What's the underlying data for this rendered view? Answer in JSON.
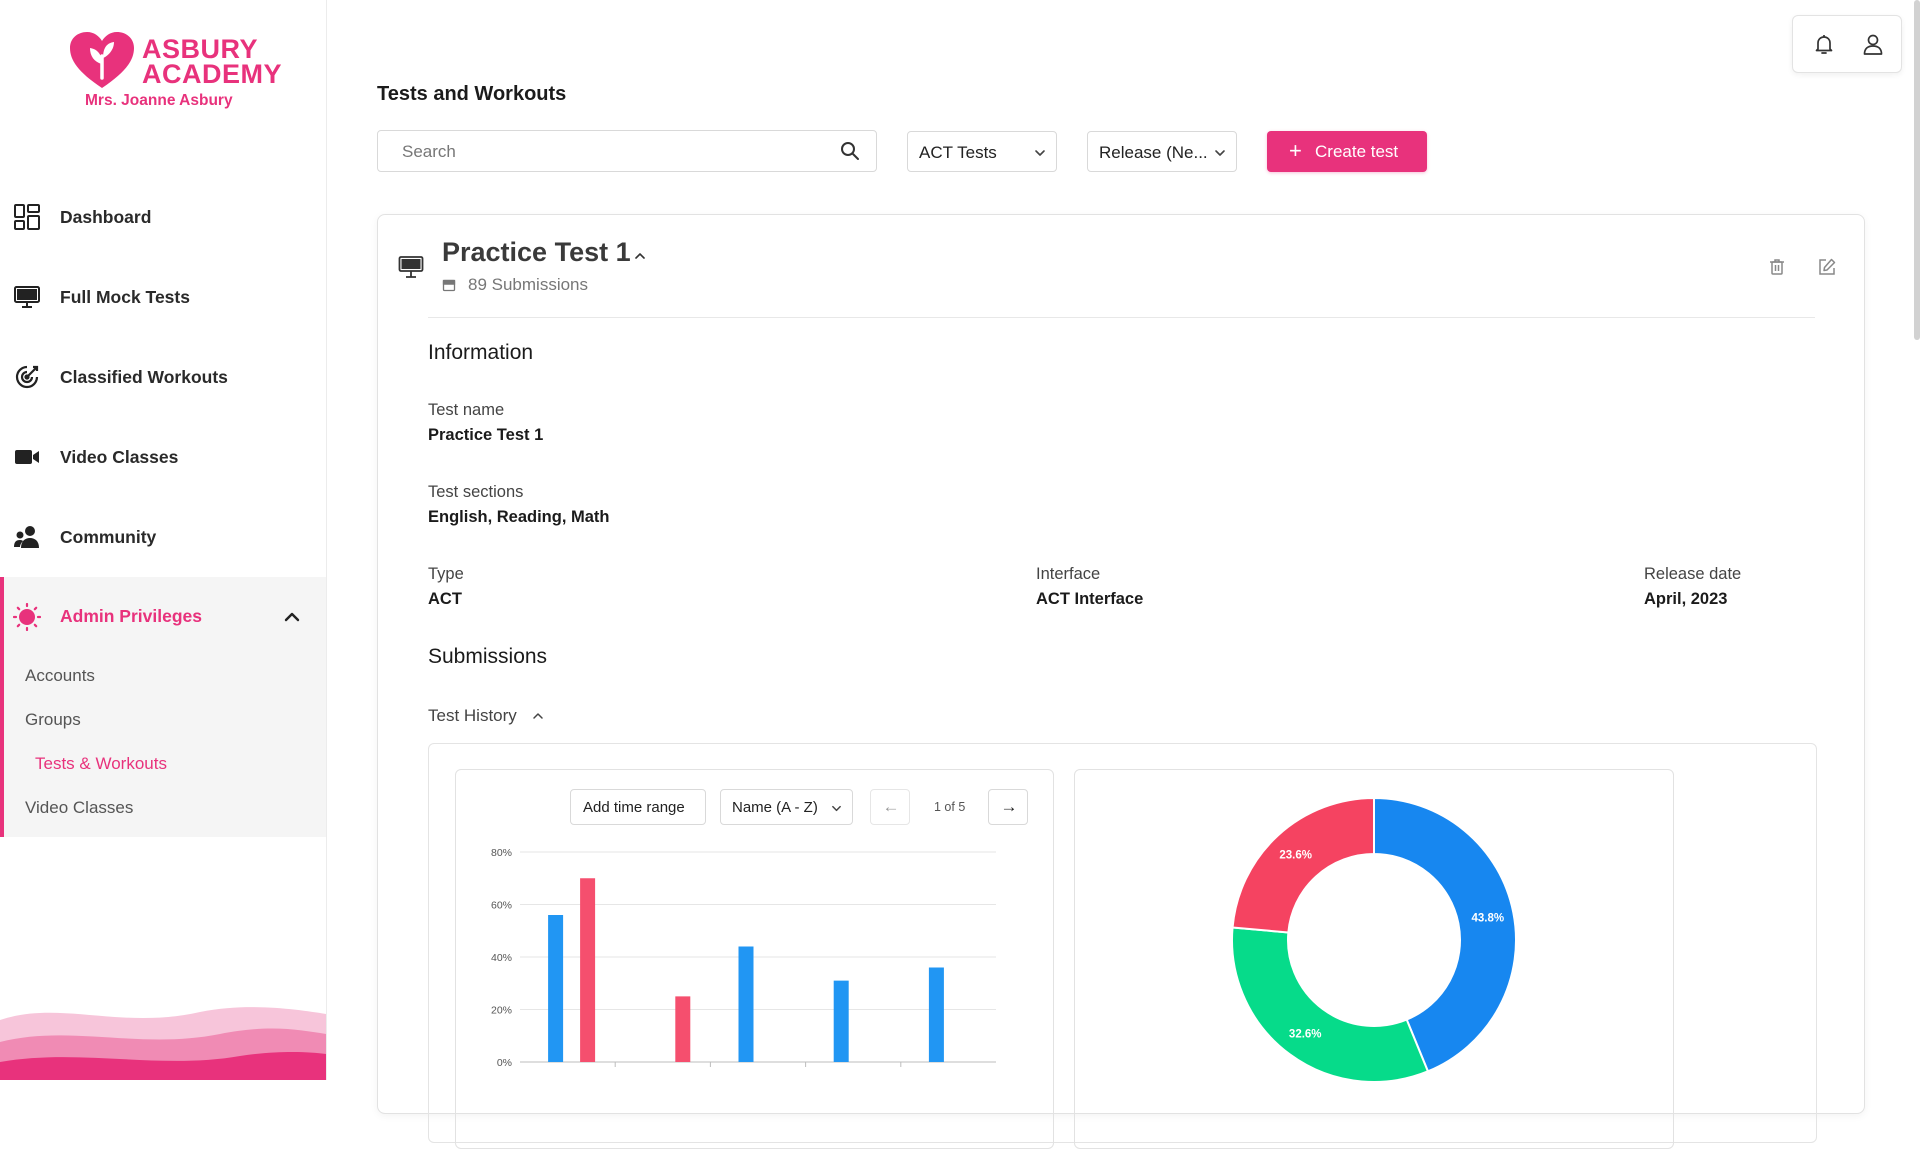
{
  "brand": {
    "name_line1": "ASBURY",
    "name_line2": "ACADEMY",
    "owner": "Mrs. Joanne Asbury",
    "accent": "#e8327c"
  },
  "sidebar": {
    "items": [
      {
        "label": "Dashboard",
        "icon": "dashboard-icon"
      },
      {
        "label": "Full Mock Tests",
        "icon": "monitor-icon"
      },
      {
        "label": "Classified Workouts",
        "icon": "target-icon"
      },
      {
        "label": "Video Classes",
        "icon": "video-icon"
      },
      {
        "label": "Community",
        "icon": "community-icon"
      }
    ],
    "admin": {
      "label": "Admin Privileges",
      "icon": "admin-icon",
      "expanded": true,
      "subitems": [
        {
          "label": "Accounts"
        },
        {
          "label": "Groups"
        },
        {
          "label": "Tests & Workouts",
          "active": true
        },
        {
          "label": "Video Classes"
        }
      ]
    }
  },
  "header": {
    "title": "Tests and Workouts",
    "search_placeholder": "Search",
    "filter_type": "ACT Tests",
    "filter_sort": "Release (Ne...",
    "create_label": "Create test",
    "create_icon": "plus-icon"
  },
  "test": {
    "title": "Practice Test 1",
    "submissions_count": "89 Submissions",
    "information_heading": "Information",
    "fields": {
      "test_name_label": "Test name",
      "test_name_value": "Practice Test 1",
      "sections_label": "Test sections",
      "sections_value": "English, Reading, Math",
      "type_label": "Type",
      "type_value": "ACT",
      "interface_label": "Interface",
      "interface_value": "ACT Interface",
      "release_label": "Release date",
      "release_value": "April, 2023"
    },
    "submissions_heading": "Submissions",
    "history_label": "Test History"
  },
  "history_controls": {
    "time_range_label": "Add time range",
    "sort_label": "Name (A - Z)",
    "prev_symbol": "←",
    "next_symbol": "→",
    "pager": "1 of 5"
  },
  "chart_data": [
    {
      "type": "bar",
      "categories": [
        "",
        "",
        "",
        "",
        ""
      ],
      "series": [
        {
          "color": "#2196f3",
          "values": [
            56,
            0,
            44,
            31,
            36
          ]
        },
        {
          "color": "#f54f6e",
          "values": [
            70,
            25,
            0,
            0,
            0
          ]
        }
      ],
      "y_ticks": [
        "0%",
        "20%",
        "40%",
        "60%",
        "80%"
      ],
      "ylim": [
        0,
        80
      ],
      "grid": true
    },
    {
      "type": "pie",
      "donut": true,
      "slices": [
        {
          "label": "43.8%",
          "value": 43.8,
          "color": "#1787f0"
        },
        {
          "label": "32.6%",
          "value": 32.6,
          "color": "#06db8a"
        },
        {
          "label": "23.6%",
          "value": 23.6,
          "color": "#f54361"
        }
      ]
    }
  ]
}
